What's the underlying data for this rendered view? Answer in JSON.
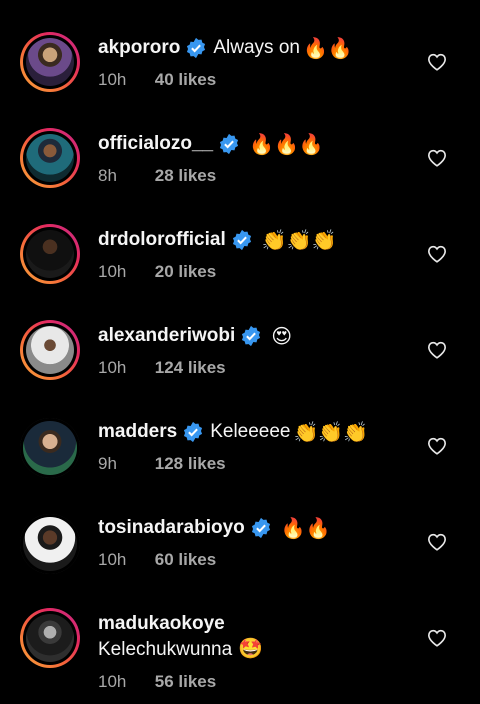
{
  "colors": {
    "background": "#000000",
    "text_primary": "#f5f5f5",
    "text_secondary": "#a8a8a8",
    "verified_badge": "#3897f0",
    "story_ring": "#e4295f"
  },
  "icons": {
    "verified": "verified-badge-icon",
    "like": "heart-outline-icon"
  },
  "comments": [
    {
      "username": "akpororo",
      "verified": true,
      "text": "Always on",
      "emoji": "🔥🔥",
      "time": "10h",
      "likes": "40 likes"
    },
    {
      "username": "officialozo__",
      "verified": true,
      "text": "",
      "emoji": "🔥🔥🔥",
      "time": "8h",
      "likes": "28 likes"
    },
    {
      "username": "drdolorofficial",
      "verified": true,
      "text": "",
      "emoji": "👏👏👏",
      "time": "10h",
      "likes": "20 likes"
    },
    {
      "username": "alexanderiwobi",
      "verified": true,
      "text": "",
      "emoji": "😍",
      "time": "10h",
      "likes": "124 likes"
    },
    {
      "username": "madders",
      "verified": true,
      "text": "Keleeeee",
      "emoji": "👏👏👏",
      "time": "9h",
      "likes": "128 likes"
    },
    {
      "username": "tosinadarabioyo",
      "verified": true,
      "text": "",
      "emoji": "🔥🔥",
      "time": "10h",
      "likes": "60 likes"
    },
    {
      "username": "madukaokoye",
      "verified": false,
      "text": "Kelechukwunna",
      "emoji": "🤩",
      "time": "10h",
      "likes": "56 likes"
    }
  ]
}
